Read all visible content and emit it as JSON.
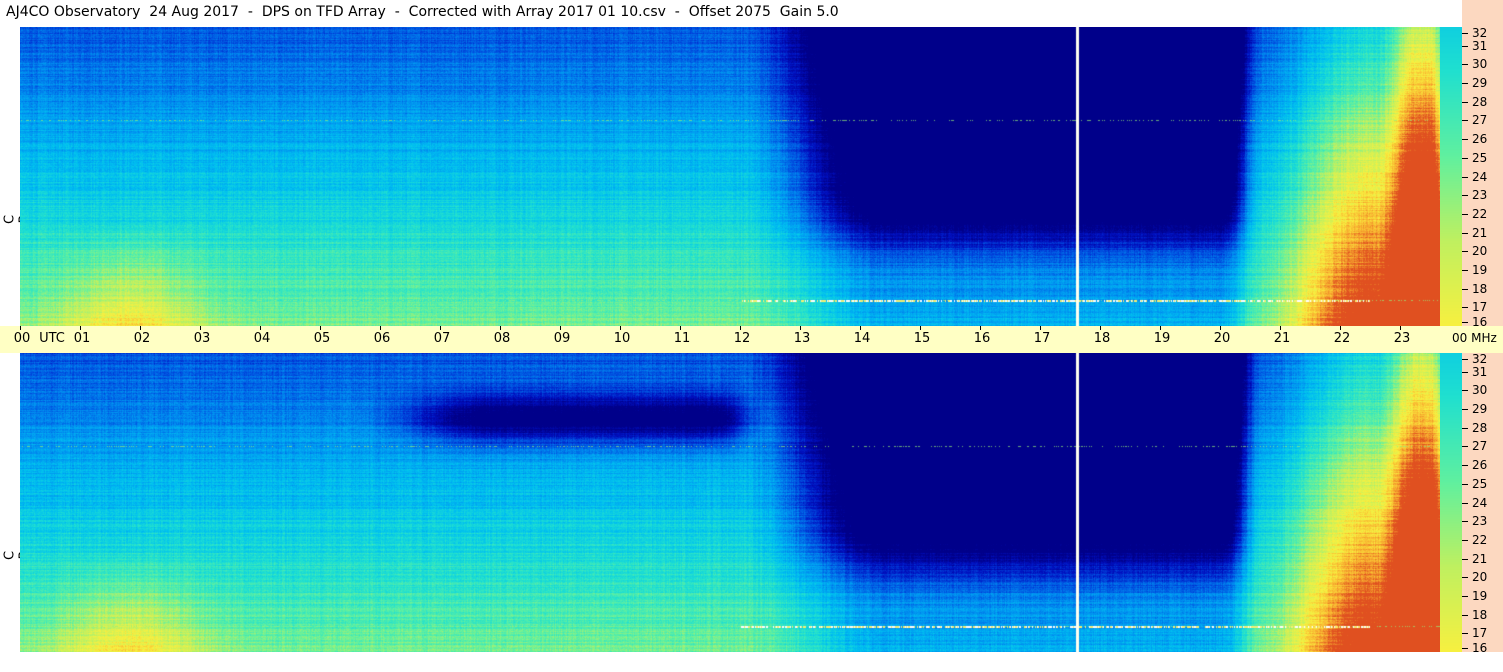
{
  "title": "AJ4CO Observatory  24 Aug 2017  -  DPS on TFD Array  -  Corrected with Array 2017 01 10.csv  -  Offset 2075  Gain 5.0",
  "panels": [
    {
      "id": "rcp",
      "polarization_label": "R  C  P"
    },
    {
      "id": "lcp",
      "polarization_label": "L  C  P"
    }
  ],
  "time_axis": {
    "unit_label": "UTC",
    "ticks": [
      "00",
      "01",
      "02",
      "03",
      "04",
      "05",
      "06",
      "07",
      "08",
      "09",
      "10",
      "11",
      "12",
      "13",
      "14",
      "15",
      "16",
      "17",
      "18",
      "19",
      "20",
      "21",
      "22",
      "23",
      "00"
    ]
  },
  "frequency_axis": {
    "unit_label": "MHz",
    "ticks": [
      32,
      31,
      30,
      29,
      28,
      27,
      26,
      25,
      24,
      23,
      22,
      21,
      20,
      19,
      18,
      17,
      16
    ]
  },
  "colors": {
    "axis_strip_time": "#ffffc4",
    "axis_strip_freq": "#fcd8c0",
    "colormap": [
      "#00008a",
      "#0010c0",
      "#0050e0",
      "#0090f0",
      "#00c0f0",
      "#20e0d0",
      "#60f0a0",
      "#c0f060",
      "#f8f040",
      "#f8b030",
      "#e05020"
    ]
  },
  "chart_data": {
    "type": "heatmap",
    "title": "AJ4CO Observatory  24 Aug 2017  -  DPS on TFD Array  -  Corrected with Array 2017 01 10.csv  -  Offset 2075  Gain 5.0",
    "xlabel": "UTC",
    "ylabel": "MHz",
    "xlim": [
      0,
      24
    ],
    "ylim": [
      16,
      32
    ],
    "series": [
      {
        "name": "R C P",
        "notes_hours": {
          "dark_period_start": 14.5,
          "dark_period_end": 20.5,
          "marker_hour": 17.6
        }
      },
      {
        "name": "L C P",
        "notes_hours": {
          "dark_period_start": 14.5,
          "dark_period_end": 20.5,
          "marker_hour": 17.6
        }
      }
    ],
    "persistent_interference_mhz": [
      17.4,
      27.0
    ],
    "grid": false
  }
}
